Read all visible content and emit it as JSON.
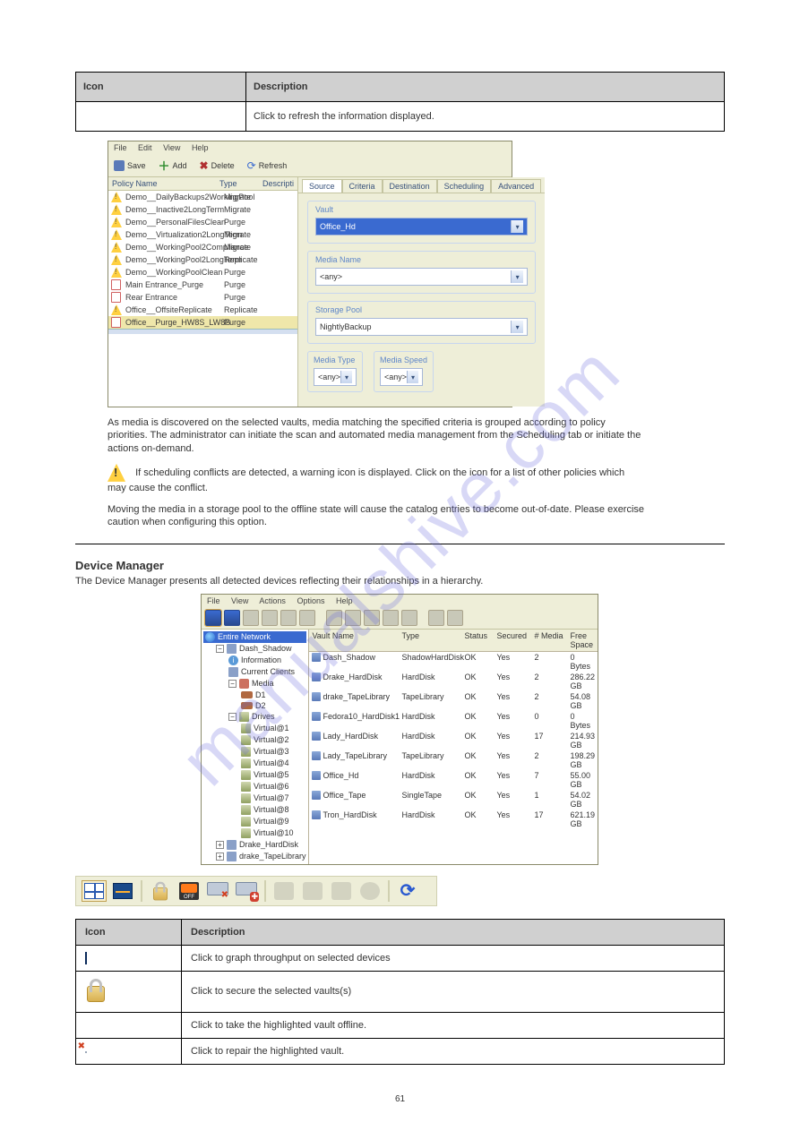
{
  "top_table": {
    "headers": [
      "Icon",
      "Description"
    ],
    "row_icon": "",
    "row_desc": "Click to refresh the information displayed."
  },
  "shot1": {
    "menu": [
      "File",
      "Edit",
      "View",
      "Help"
    ],
    "toolbar": {
      "save": "Save",
      "add": "Add",
      "delete": "Delete",
      "refresh": "Refresh"
    },
    "list_headers": {
      "name": "Policy Name",
      "type": "Type",
      "desc": "Descripti"
    },
    "policies": [
      {
        "ic": "warn",
        "name": "Demo__DailyBackups2WorkingPool",
        "type": "Migrate"
      },
      {
        "ic": "warn",
        "name": "Demo__Inactive2LongTerm",
        "type": "Migrate"
      },
      {
        "ic": "warn",
        "name": "Demo__PersonalFilesClean",
        "type": "Purge"
      },
      {
        "ic": "warn",
        "name": "Demo__Virtualization2LongTerm",
        "type": "Migrate"
      },
      {
        "ic": "warn",
        "name": "Demo__WorkingPool2Compliance",
        "type": "Migrate"
      },
      {
        "ic": "warn",
        "name": "Demo__WorkingPool2LongTerm",
        "type": "Replicate"
      },
      {
        "ic": "warn",
        "name": "Demo__WorkingPoolClean",
        "type": "Purge"
      },
      {
        "ic": "doc",
        "name": "Main Entrance_Purge",
        "type": "Purge"
      },
      {
        "ic": "doc",
        "name": "Rear Entrance",
        "type": "Purge"
      },
      {
        "ic": "warn",
        "name": "Office__OffsiteReplicate",
        "type": "Replicate"
      },
      {
        "ic": "doc",
        "name": "Office__Purge_HW8S_LW8S",
        "type": "Purge",
        "sel": true
      }
    ],
    "tabs": [
      "Source",
      "Criteria",
      "Destination",
      "Scheduling",
      "Advanced"
    ],
    "groups": {
      "vault_lbl": "Vault",
      "vault_val": "Office_Hd",
      "media_lbl": "Media Name",
      "media_val": "<any>",
      "pool_lbl": "Storage Pool",
      "pool_val": "NightlyBackup",
      "type_lbl": "Media Type",
      "type_val": "<any>",
      "speed_lbl": "Media Speed",
      "speed_val": "<any>"
    }
  },
  "para1": "As media is discovered on the selected vaults, media matching the specified criteria is grouped according to policy priorities. The administrator can initiate the scan and automated media management from the Scheduling tab or initiate the actions on-demand.",
  "para2": "If scheduling conflicts are detected, a warning icon is displayed. Click on the icon for a list of other policies which may cause the conflict.",
  "para3": "Moving the media in a storage pool to the offline state will cause the catalog entries to become out-of-date. Please exercise caution when configuring this option.",
  "heading": "Device Manager",
  "subtext": "The Device Manager presents all detected devices reflecting their relationships in a hierarchy.",
  "shot2": {
    "menu": [
      "File",
      "View",
      "Actions",
      "Options",
      "Help"
    ],
    "headers": [
      "Vault Name",
      "Type",
      "Status",
      "Secured",
      "# Media",
      "Free Space"
    ],
    "tree_root": "Entire Network",
    "tree": {
      "dash": "Dash_Shadow",
      "info": "Information",
      "clients": "Current Clients",
      "media": "Media",
      "d1": "D1",
      "d2": "D2",
      "drives": "Drives",
      "v": [
        "Virtual@1",
        "Virtual@2",
        "Virtual@3",
        "Virtual@4",
        "Virtual@5",
        "Virtual@6",
        "Virtual@7",
        "Virtual@8",
        "Virtual@9",
        "Virtual@10"
      ],
      "drake_hd": "Drake_HardDisk",
      "drake_tl": "drake_TapeLibrary"
    },
    "rows": [
      {
        "name": "Dash_Shadow",
        "type": "ShadowHardDisk",
        "status": "OK",
        "secured": "Yes",
        "media": "2",
        "free": "0 Bytes"
      },
      {
        "name": "Drake_HardDisk",
        "type": "HardDisk",
        "status": "OK",
        "secured": "Yes",
        "media": "2",
        "free": "286.22 GB"
      },
      {
        "name": "drake_TapeLibrary",
        "type": "TapeLibrary",
        "status": "OK",
        "secured": "Yes",
        "media": "2",
        "free": "54.08 GB"
      },
      {
        "name": "Fedora10_HardDisk1",
        "type": "HardDisk",
        "status": "OK",
        "secured": "Yes",
        "media": "0",
        "free": "0 Bytes"
      },
      {
        "name": "Lady_HardDisk",
        "type": "HardDisk",
        "status": "OK",
        "secured": "Yes",
        "media": "17",
        "free": "214.93 GB"
      },
      {
        "name": "Lady_TapeLibrary",
        "type": "TapeLibrary",
        "status": "OK",
        "secured": "Yes",
        "media": "2",
        "free": "198.29 GB"
      },
      {
        "name": "Office_Hd",
        "type": "HardDisk",
        "status": "OK",
        "secured": "Yes",
        "media": "7",
        "free": "55.00 GB"
      },
      {
        "name": "Office_Tape",
        "type": "SingleTape",
        "status": "OK",
        "secured": "Yes",
        "media": "1",
        "free": "54.02 GB"
      },
      {
        "name": "Tron_HardDisk",
        "type": "HardDisk",
        "status": "OK",
        "secured": "Yes",
        "media": "17",
        "free": "621.19 GB"
      }
    ]
  },
  "icons_table": {
    "hdr_icon": "Icon",
    "hdr_desc": "Description",
    "rows": [
      "Click to graph throughput on selected devices",
      "Click to secure the selected vaults(s)",
      "Click to take the highlighted vault offline.",
      "Click to repair the highlighted vault."
    ]
  },
  "page_number": "61"
}
